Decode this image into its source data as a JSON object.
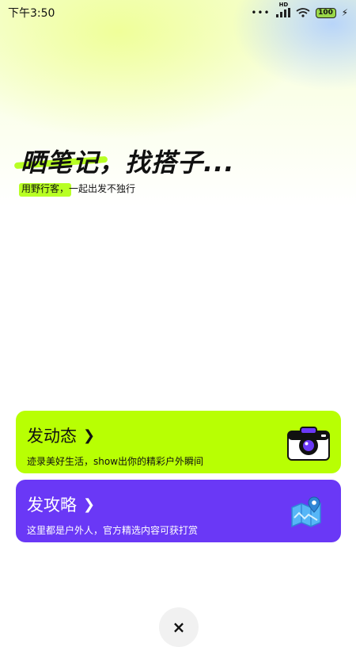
{
  "status_bar": {
    "time": "下午3:50",
    "signal_label": "HD",
    "battery": "100",
    "icons": [
      "dots-icon",
      "signal-icon",
      "wifi-icon",
      "battery-icon",
      "charging-icon"
    ]
  },
  "hero": {
    "headline": "晒笔记，找搭子...",
    "subtitle": "用野行客，一起出发不独行"
  },
  "cards": [
    {
      "title": "发动态",
      "description": "迹录美好生活，show出你的精彩户外瞬间",
      "icon": "camera-icon",
      "color": "#b8ff03"
    },
    {
      "title": "发攻略",
      "description": "这里都是户外人，官方精选内容可获打赏",
      "icon": "map-icon",
      "color": "#6a38f6"
    }
  ],
  "close": {
    "label": "×"
  }
}
